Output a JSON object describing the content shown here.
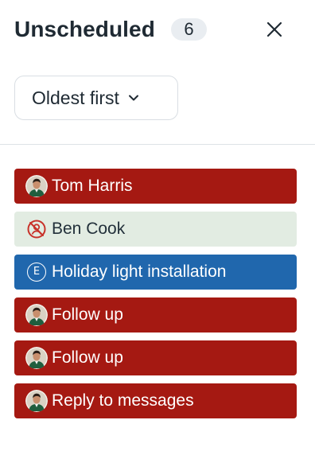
{
  "header": {
    "title": "Unscheduled",
    "count": "6",
    "close_icon": "close-icon"
  },
  "sort": {
    "label": "Oldest first",
    "icon": "chevron-down-icon"
  },
  "colors": {
    "red": "#a51912",
    "grey": "#e2ece2",
    "blue": "#2067ad"
  },
  "items": [
    {
      "label": "Tom Harris",
      "icon": "user-avatar",
      "color": "red"
    },
    {
      "label": "Ben Cook",
      "icon": "no-avatar-icon",
      "color": "grey"
    },
    {
      "label": "Holiday light installation",
      "icon": "event-icon",
      "icon_text": "E",
      "color": "blue"
    },
    {
      "label": "Follow up",
      "icon": "user-avatar",
      "color": "red"
    },
    {
      "label": "Follow up",
      "icon": "user-avatar",
      "color": "red"
    },
    {
      "label": "Reply to messages",
      "icon": "user-avatar",
      "color": "red"
    }
  ]
}
